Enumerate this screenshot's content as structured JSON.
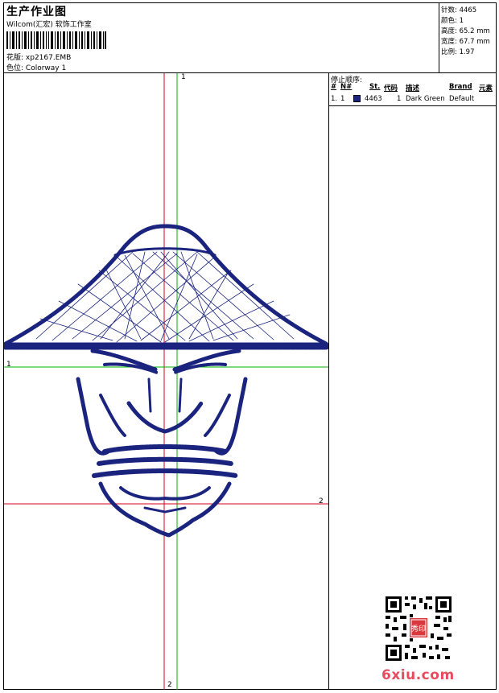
{
  "header": {
    "title": "生产作业图",
    "software": "Wilcom(汇宏) 软饰工作室",
    "pattern_label": "花版:",
    "pattern_value": "xp2167.EMB",
    "colorway_label": "色位:",
    "colorway_value": "Colorway 1"
  },
  "stats": {
    "stitches": "针数: 4465",
    "colors": "颜色: 1",
    "height": "高度: 65.2 mm",
    "width": "宽度: 67.7 mm",
    "ratio": "比例: 1.97"
  },
  "stop_sequence": {
    "title": "停止顺序:",
    "columns": [
      "#",
      "N#",
      "St.",
      "代码",
      "描述",
      "Brand",
      "元素"
    ],
    "rows": [
      {
        "index": "1.",
        "needle": "1",
        "stitches": "4463",
        "code": "1",
        "description": "Dark Green",
        "brand": "Default",
        "swatch_color": "#1a237e"
      }
    ]
  },
  "axes": {
    "v1_label": "1",
    "h1_label": "1",
    "h2_label": "2",
    "v2_label": "2"
  },
  "colors": {
    "thread": "#1a237e",
    "red_guide": "#d4001a",
    "green_guide": "#00b000",
    "watermark": "#e64b5f"
  },
  "watermark": "6xiu.com",
  "stamp": "秀印"
}
